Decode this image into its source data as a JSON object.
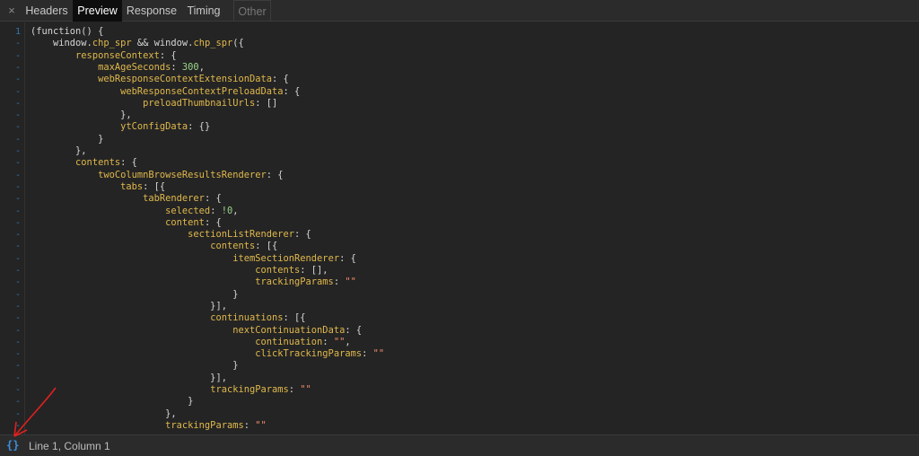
{
  "tabs": {
    "close": "×",
    "items": [
      {
        "label": "Headers",
        "state": "normal"
      },
      {
        "label": "Preview",
        "state": "active"
      },
      {
        "label": "Response",
        "state": "normal"
      },
      {
        "label": "Timing",
        "state": "normal"
      },
      {
        "label": "Other",
        "state": "disabled"
      }
    ]
  },
  "editor": {
    "first_line_number": "1",
    "folded_marker": "-",
    "lines": [
      [
        [
          "p",
          "(function() {"
        ]
      ],
      [
        [
          "p",
          "    window."
        ],
        [
          "m",
          "chp_spr"
        ],
        [
          "p",
          " && window."
        ],
        [
          "m",
          "chp_spr"
        ],
        [
          "p",
          "({"
        ]
      ],
      [
        [
          "p",
          "        "
        ],
        [
          "k",
          "responseContext"
        ],
        [
          "p",
          ": {"
        ]
      ],
      [
        [
          "p",
          "            "
        ],
        [
          "k",
          "maxAgeSeconds"
        ],
        [
          "p",
          ": "
        ],
        [
          "n",
          "300"
        ],
        [
          "p",
          ","
        ]
      ],
      [
        [
          "p",
          "            "
        ],
        [
          "k",
          "webResponseContextExtensionData"
        ],
        [
          "p",
          ": {"
        ]
      ],
      [
        [
          "p",
          "                "
        ],
        [
          "k",
          "webResponseContextPreloadData"
        ],
        [
          "p",
          ": {"
        ]
      ],
      [
        [
          "p",
          "                    "
        ],
        [
          "k",
          "preloadThumbnailUrls"
        ],
        [
          "p",
          ": []"
        ]
      ],
      [
        [
          "p",
          "                },"
        ]
      ],
      [
        [
          "p",
          "                "
        ],
        [
          "k",
          "ytConfigData"
        ],
        [
          "p",
          ": {}"
        ]
      ],
      [
        [
          "p",
          "            }"
        ]
      ],
      [
        [
          "p",
          "        },"
        ]
      ],
      [
        [
          "p",
          "        "
        ],
        [
          "k",
          "contents"
        ],
        [
          "p",
          ": {"
        ]
      ],
      [
        [
          "p",
          "            "
        ],
        [
          "k",
          "twoColumnBrowseResultsRenderer"
        ],
        [
          "p",
          ": {"
        ]
      ],
      [
        [
          "p",
          "                "
        ],
        [
          "k",
          "tabs"
        ],
        [
          "p",
          ": [{"
        ]
      ],
      [
        [
          "p",
          "                    "
        ],
        [
          "k",
          "tabRenderer"
        ],
        [
          "p",
          ": {"
        ]
      ],
      [
        [
          "p",
          "                        "
        ],
        [
          "k",
          "selected"
        ],
        [
          "p",
          ": "
        ],
        [
          "n",
          "!0"
        ],
        [
          "p",
          ","
        ]
      ],
      [
        [
          "p",
          "                        "
        ],
        [
          "k",
          "content"
        ],
        [
          "p",
          ": {"
        ]
      ],
      [
        [
          "p",
          "                            "
        ],
        [
          "k",
          "sectionListRenderer"
        ],
        [
          "p",
          ": {"
        ]
      ],
      [
        [
          "p",
          "                                "
        ],
        [
          "k",
          "contents"
        ],
        [
          "p",
          ": [{"
        ]
      ],
      [
        [
          "p",
          "                                    "
        ],
        [
          "k",
          "itemSectionRenderer"
        ],
        [
          "p",
          ": {"
        ]
      ],
      [
        [
          "p",
          "                                        "
        ],
        [
          "k",
          "contents"
        ],
        [
          "p",
          ": [],"
        ]
      ],
      [
        [
          "p",
          "                                        "
        ],
        [
          "k",
          "trackingParams"
        ],
        [
          "p",
          ": "
        ],
        [
          "s",
          "\"\""
        ]
      ],
      [
        [
          "p",
          "                                    }"
        ]
      ],
      [
        [
          "p",
          "                                }],"
        ]
      ],
      [
        [
          "p",
          "                                "
        ],
        [
          "k",
          "continuations"
        ],
        [
          "p",
          ": [{"
        ]
      ],
      [
        [
          "p",
          "                                    "
        ],
        [
          "k",
          "nextContinuationData"
        ],
        [
          "p",
          ": {"
        ]
      ],
      [
        [
          "p",
          "                                        "
        ],
        [
          "k",
          "continuation"
        ],
        [
          "p",
          ": "
        ],
        [
          "s",
          "\"\""
        ],
        [
          "p",
          ","
        ]
      ],
      [
        [
          "p",
          "                                        "
        ],
        [
          "k",
          "clickTrackingParams"
        ],
        [
          "p",
          ": "
        ],
        [
          "s",
          "\"\""
        ]
      ],
      [
        [
          "p",
          "                                    }"
        ]
      ],
      [
        [
          "p",
          "                                }],"
        ]
      ],
      [
        [
          "p",
          "                                "
        ],
        [
          "k",
          "trackingParams"
        ],
        [
          "p",
          ": "
        ],
        [
          "s",
          "\"\""
        ]
      ],
      [
        [
          "p",
          "                            }"
        ]
      ],
      [
        [
          "p",
          "                        },"
        ]
      ],
      [
        [
          "p",
          "                        "
        ],
        [
          "k",
          "trackingParams"
        ],
        [
          "p",
          ": "
        ],
        [
          "s",
          "\"\""
        ]
      ]
    ]
  },
  "status": {
    "icon": "{}",
    "icon_name": "pretty-print-icon",
    "text": "Line 1, Column 1"
  },
  "annotation": {
    "arrow_color": "#e02020"
  }
}
